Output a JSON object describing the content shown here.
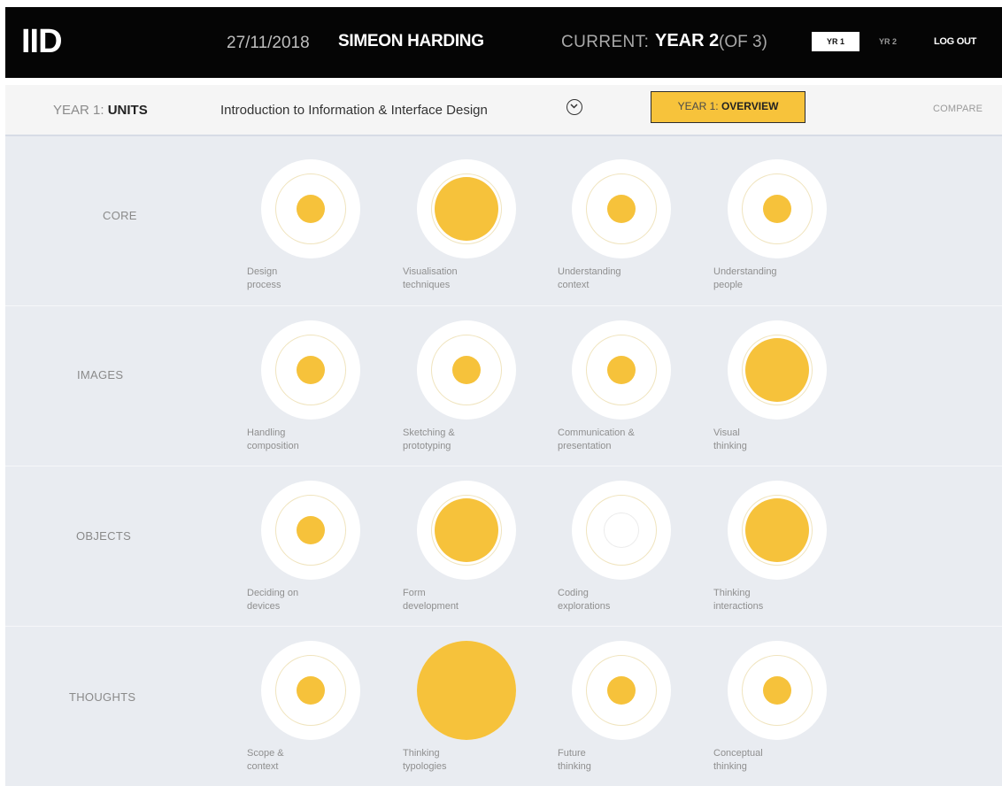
{
  "header": {
    "logo": "IID",
    "date": "27/11/2018",
    "user": "SIMEON HARDING",
    "current_label": "CURRENT:",
    "current_year": "YEAR 2",
    "current_of": "(OF 3)",
    "yr1_label": "YR 1",
    "yr2_label": "YR 2",
    "logout_label": "LOG OUT"
  },
  "subheader": {
    "year_prefix": "YEAR 1:",
    "year_section": "UNITS",
    "unit_title": "Introduction to Information & Interface Design",
    "overview_prefix": "YEAR 1:",
    "overview_label": "OVERVIEW",
    "compare_label": "COMPARE"
  },
  "colors": {
    "accent": "#f6c23b",
    "header_bg": "#050505",
    "grid_bg": "#e9ecf1"
  },
  "rows": [
    {
      "label": "CORE",
      "skills": [
        {
          "line1": "Design",
          "line2": "process",
          "level": 1
        },
        {
          "line1": "Visualisation",
          "line2": "techniques",
          "level": 3
        },
        {
          "line1": "Understanding",
          "line2": "context",
          "level": 1
        },
        {
          "line1": "Understanding",
          "line2": "people",
          "level": 1
        }
      ]
    },
    {
      "label": "IMAGES",
      "skills": [
        {
          "line1": "Handling",
          "line2": "composition",
          "level": 1
        },
        {
          "line1": "Sketching &",
          "line2": "prototyping",
          "level": 1
        },
        {
          "line1": "Communication &",
          "line2": "presentation",
          "level": 1
        },
        {
          "line1": "Visual",
          "line2": "thinking",
          "level": 3
        }
      ]
    },
    {
      "label": "OBJECTS",
      "skills": [
        {
          "line1": "Deciding on",
          "line2": "devices",
          "level": 1
        },
        {
          "line1": "Form",
          "line2": "development",
          "level": 3
        },
        {
          "line1": "Coding",
          "line2": "explorations",
          "level": 0
        },
        {
          "line1": "Thinking",
          "line2": "interactions",
          "level": 3
        }
      ]
    },
    {
      "label": "THOUGHTS",
      "skills": [
        {
          "line1": "Scope &",
          "line2": "context",
          "level": 1
        },
        {
          "line1": "Thinking",
          "line2": "typologies",
          "level": 4
        },
        {
          "line1": "Future",
          "line2": "thinking",
          "level": 1
        },
        {
          "line1": "Conceptual",
          "line2": "thinking",
          "level": 1
        }
      ]
    }
  ]
}
